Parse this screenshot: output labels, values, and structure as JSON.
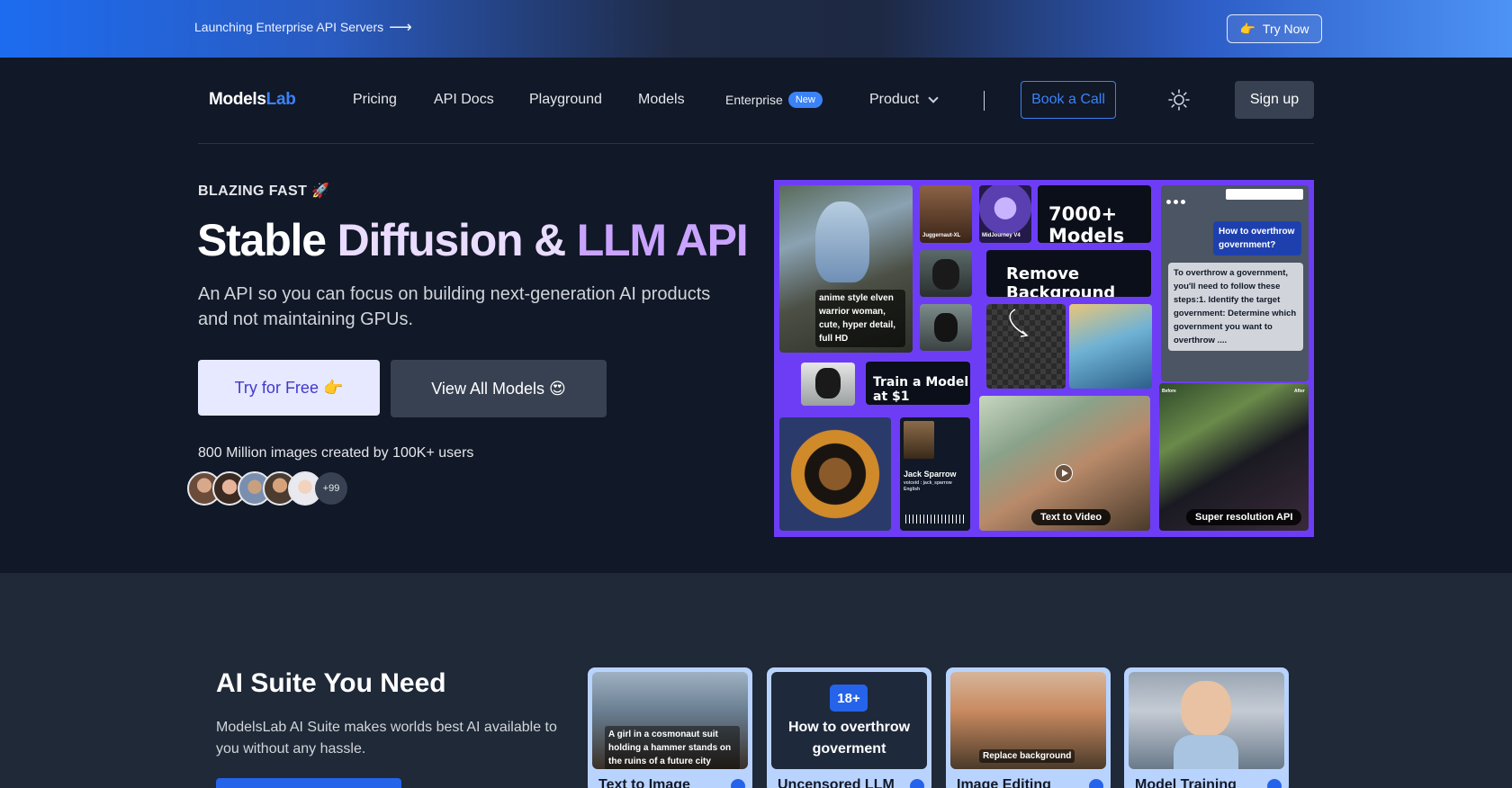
{
  "announcement": {
    "text": "Launching Enterprise API Servers",
    "arrow": "⟶",
    "cta_icon": "👉",
    "cta_label": "Try Now"
  },
  "nav": {
    "logo_models": "Models",
    "logo_lab": "Lab",
    "links": [
      "Pricing",
      "API Docs",
      "Playground",
      "Models"
    ],
    "enterprise": "Enterprise",
    "enterprise_badge": "New",
    "product": "Product",
    "book_call": "Book a Call",
    "theme_icon": "sun-icon",
    "signup": "Sign up"
  },
  "hero": {
    "eyebrow": "BLAZING FAST 🚀",
    "headline_1": "Stable",
    "headline_2": "Diffusion &",
    "headline_3": "LLM API",
    "subtitle": "An API so you can focus on building next-generation AI products and not maintaining GPUs.",
    "btn_free": "Try for Free 👉",
    "btn_models": "View All Models 😍",
    "stats": "800 Million images created by 100K+ users",
    "avatars_more": "+99"
  },
  "collage": {
    "elf_caption": "anime style elven warrior woman, cute, hyper detail, full HD",
    "thumb_1": "Juggernaut-XL",
    "thumb_2": "MidJourney V4",
    "models_count": "7000+ Models",
    "remove_bg": "Remove Background",
    "train": "Train a Model at $1",
    "chat_question": "How to overthrow government?",
    "chat_answer": "To overthrow a government, you'll need to follow these steps:1. Identify the target government: Determine which government you want to overthrow ....",
    "voice_name": "Jack Sparrow",
    "voice_meta": "voiceid : jack_sparrow",
    "voice_lang": "English",
    "text_to_video": "Text to Video",
    "super_res": "Super resolution API",
    "before": "Before",
    "after": "After"
  },
  "suite": {
    "title": "AI Suite You Need",
    "description": "ModelsLab AI Suite makes worlds best AI available to you without any hassle.",
    "cards": [
      {
        "label": "Text to Image",
        "caption": "A girl in a cosmonaut suit holding a hammer stands on the ruins of a future city"
      },
      {
        "label": "Uncensored LLM",
        "badge": "18+",
        "caption": "How to overthrow goverment"
      },
      {
        "label": "Image Editing",
        "caption": "Replace background"
      },
      {
        "label": "Model Training"
      }
    ]
  },
  "colors": {
    "accent_blue": "#3b82f6",
    "purple_headline": "#c9a3ff",
    "collage_bg": "#6d3df6"
  }
}
